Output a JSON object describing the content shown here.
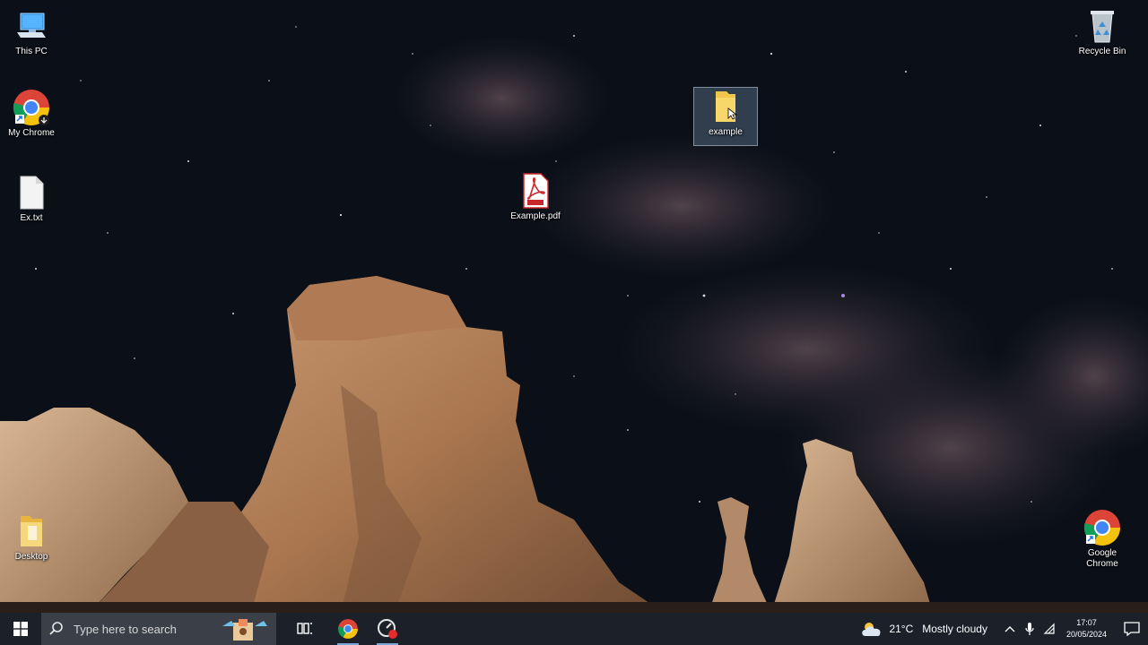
{
  "desktop": {
    "icons": {
      "this_pc": "This PC",
      "my_chrome": "My Chrome",
      "ex_txt": "Ex.txt",
      "example_pdf": "Example.pdf",
      "example_folder": "example",
      "recycle_bin": "Recycle Bin",
      "desktop_folder": "Desktop",
      "google_chrome": "Google Chrome"
    },
    "selected_icon": "example"
  },
  "taskbar": {
    "search_placeholder": "Type here to search",
    "pinned": [
      "task-view-icon",
      "chrome-icon",
      "screen-recorder-icon"
    ],
    "weather": {
      "temp": "21°C",
      "condition": "Mostly cloudy"
    },
    "clock": {
      "time": "17:07",
      "date": "20/05/2024"
    }
  },
  "colors": {
    "taskbar": "#1c2029",
    "search_box": "#3a3f48",
    "folder": "#f0c64a",
    "pdf_red": "#c8262c",
    "windows_blue": "#4aa3f0"
  }
}
